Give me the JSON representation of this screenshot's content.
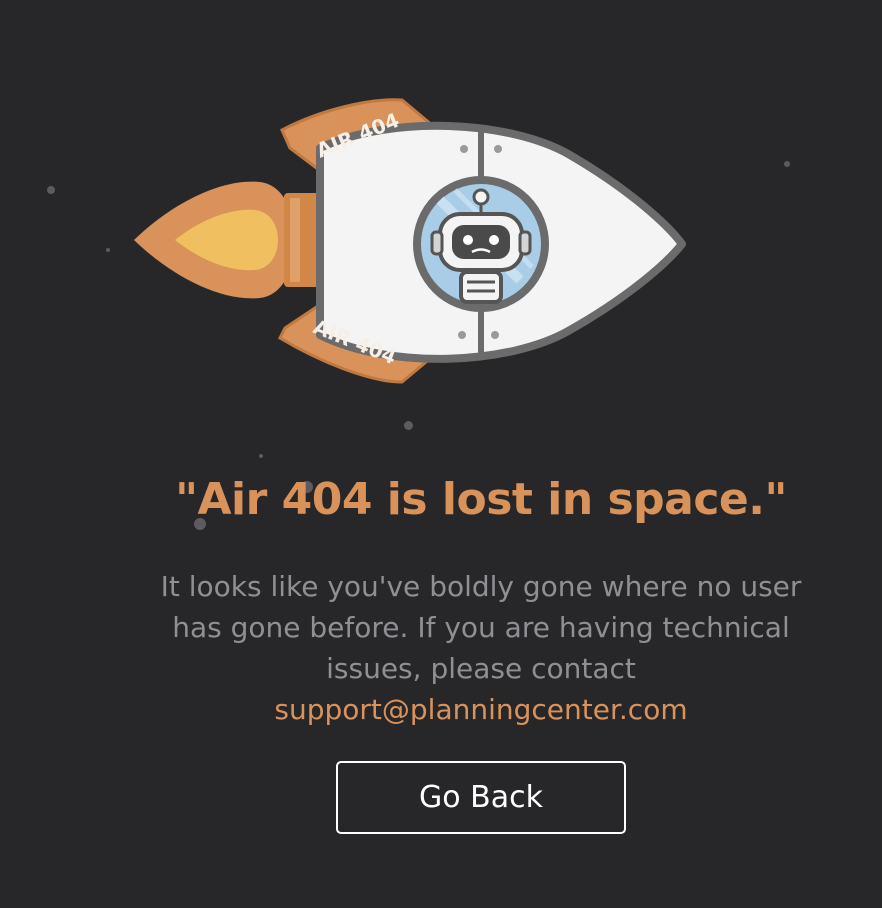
{
  "illustration": {
    "fin_label_top": "AIR 404",
    "fin_label_bottom": "AIR 404",
    "colors": {
      "background": "#27272a",
      "accent_orange": "#d9935a",
      "flame_yellow": "#f0c060",
      "hull": "#f4f4f4",
      "outline": "#6b6b6b",
      "window_blue": "#a9cde6"
    }
  },
  "content": {
    "headline": "\"Air 404 is lost in space.\"",
    "body": "It looks like you've boldly gone where no user has gone before. If you are having technical issues, please contact",
    "support_email": "support@planningcenter.com"
  },
  "actions": {
    "go_back_label": "Go Back"
  }
}
